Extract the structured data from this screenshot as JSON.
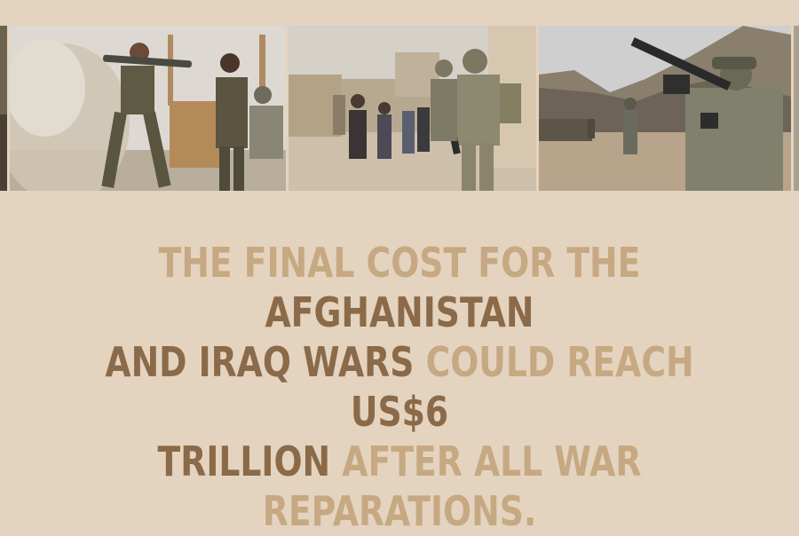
{
  "photos": [
    {
      "name": "partial-photo-left"
    },
    {
      "name": "photo-rocket-launcher-soldiers"
    },
    {
      "name": "photo-soldiers-with-villagers"
    },
    {
      "name": "photo-soldier-aiming-rifle"
    },
    {
      "name": "partial-photo-right"
    }
  ],
  "caption": {
    "line1_a": "THE FINAL COST FOR THE ",
    "line1_b": "AFGHANISTAN",
    "line2_a": "AND IRAQ WARS ",
    "line2_b": "COULD REACH ",
    "line2_c": "US$6",
    "line3_a": "TRILLION ",
    "line3_b": "AFTER ALL WAR REPARATIONS."
  },
  "colors": {
    "background": "#e4d3bf",
    "text_light": "#c6a982",
    "text_dark": "#8a6a48"
  }
}
